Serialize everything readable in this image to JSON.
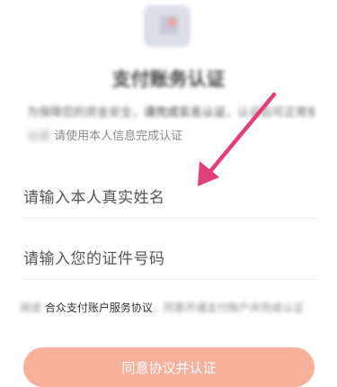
{
  "header": {
    "title": "支付账务认证"
  },
  "description": {
    "line1_prefix": "为保障您的资金安全，",
    "line1_emph": "请完成实名认证",
    "line1_suffix": "，认证后可正常使用",
    "line2_blurred": "认证",
    "line2_main": "请使用本人信息完成认证"
  },
  "form": {
    "name_placeholder": "请输入本人真实姓名",
    "id_placeholder": "请输入您的证件号码"
  },
  "agreement": {
    "prefix": "阅读",
    "link": "合众支付账户服务协议",
    "suffix": "，同意开通支付账户并完成认证"
  },
  "submit": {
    "label": "同意协议并认证"
  },
  "colors": {
    "annotation_arrow": "#e0407a",
    "submit_button": "#f6b09c"
  }
}
